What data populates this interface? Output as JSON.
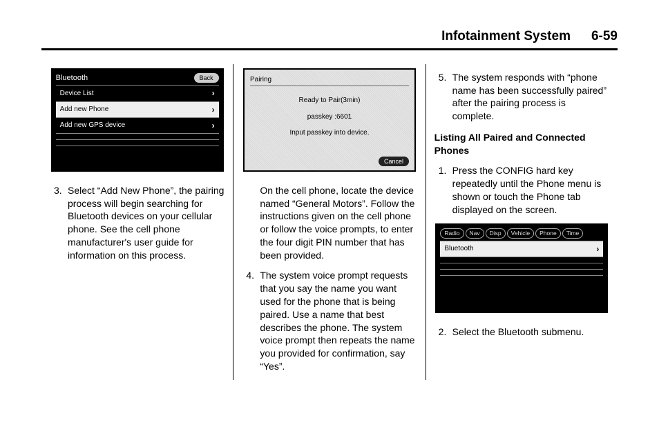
{
  "header": {
    "title": "Infotainment System",
    "page": "6-59"
  },
  "col1": {
    "screen": {
      "title": "Bluetooth",
      "back": "Back",
      "rows": [
        "Device List",
        "Add new Phone",
        "Add new GPS device"
      ]
    },
    "step3_num": "3.",
    "step3": "Select “Add New Phone”, the pairing process will begin searching for Bluetooth devices on your cellular phone. See the cell phone manufacturer's user guide for information on this process."
  },
  "col2": {
    "screen": {
      "title": "Pairing",
      "line1": "Ready to Pair(3min)",
      "line2": "passkey :6601",
      "line3": "Input passkey into device.",
      "cancel": "Cancel"
    },
    "para1": "On the cell phone, locate the device named “General Motors”. Follow the instructions given on the cell phone or follow the voice prompts, to enter the four digit PIN number that has been provided.",
    "step4_num": "4.",
    "step4": "The system voice prompt requests that you say the name you want used for the phone that is being paired. Use a name that best describes the phone. The system voice prompt then repeats the name you provided for confirmation, say “Yes”."
  },
  "col3": {
    "step5_num": "5.",
    "step5": "The system responds with “phone name has been successfully paired” after the pairing process is complete.",
    "heading": "Listing All Paired and Connected Phones",
    "step1_num": "1.",
    "step1": "Press the CONFIG hard key repeatedly until the Phone menu is shown or touch the Phone tab displayed on the screen.",
    "screen": {
      "tabs": [
        "Radio",
        "Nav",
        "Disp",
        "Vehicle",
        "Phone",
        "Time"
      ],
      "row": "Bluetooth"
    },
    "step2_num": "2.",
    "step2": "Select the Bluetooth submenu."
  }
}
